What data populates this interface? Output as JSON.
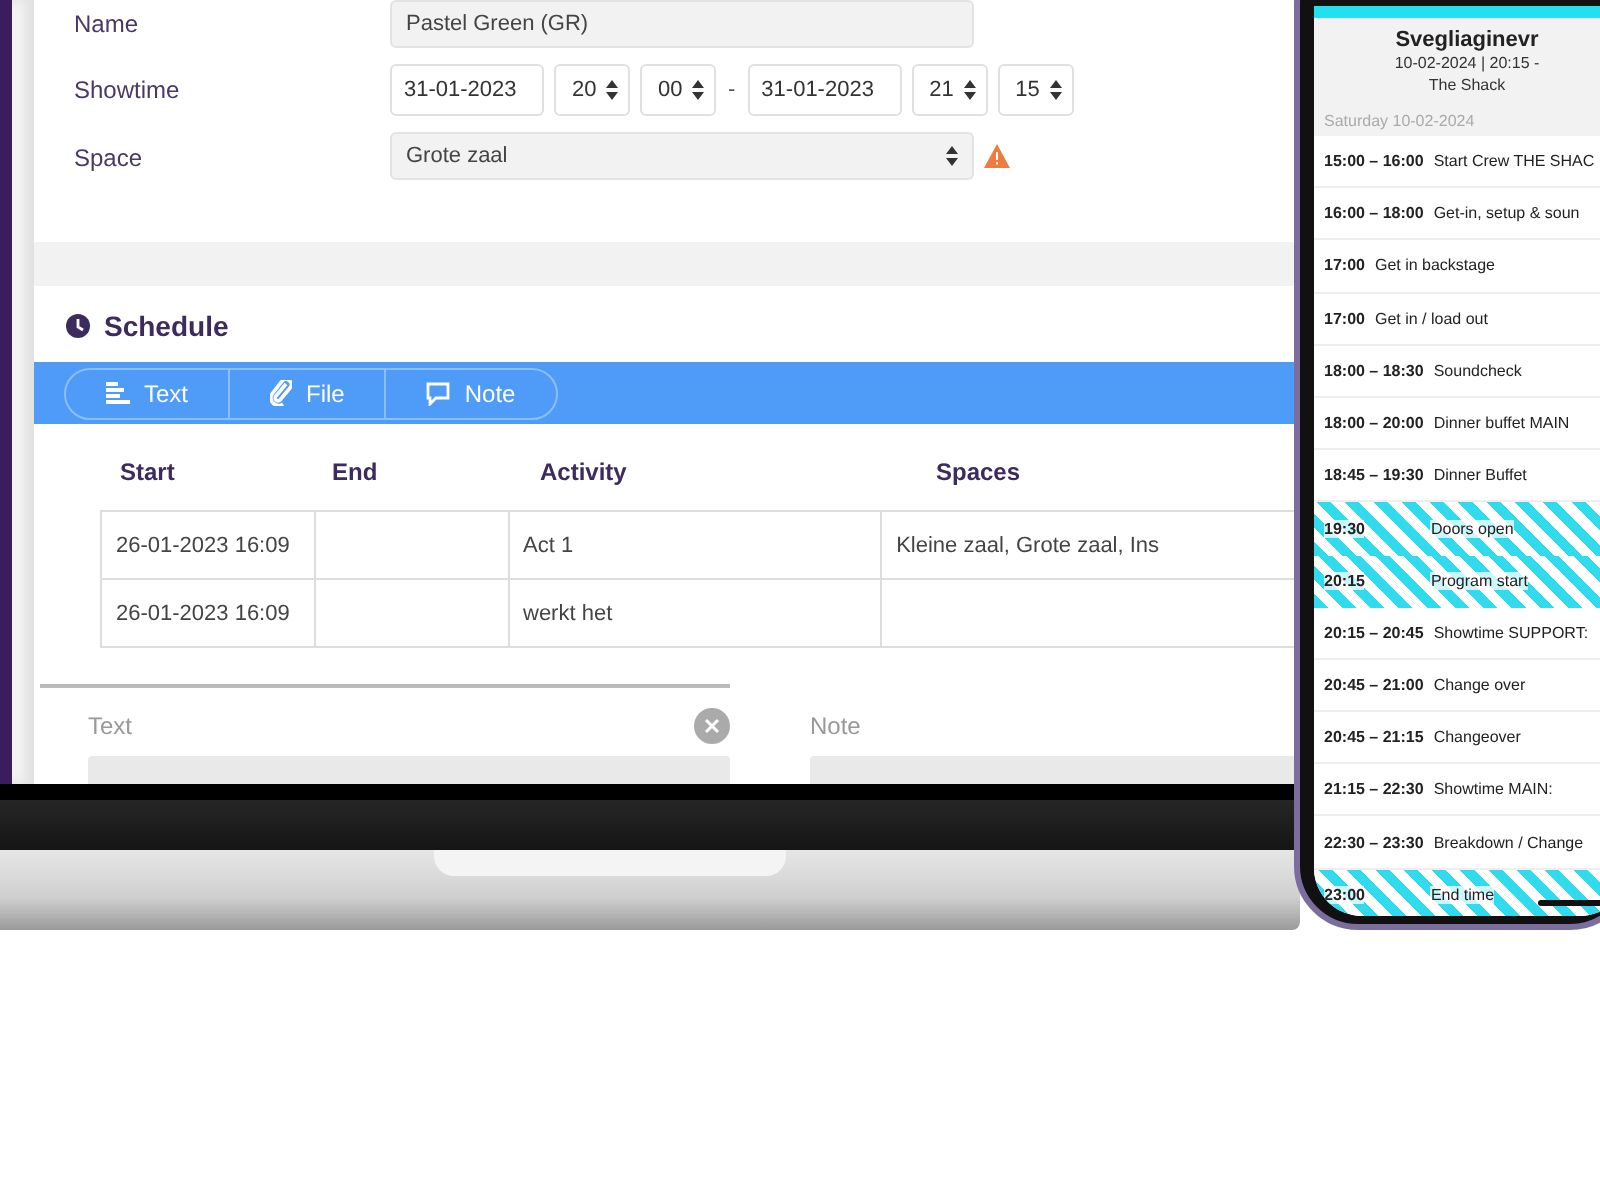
{
  "form": {
    "fields": [
      {
        "kind": "text",
        "label": "Name",
        "value": "Pastel Green (GR)"
      },
      {
        "kind": "range",
        "label": "Showtime",
        "parts": [
          {
            "kind": "date",
            "value": "31-01-2023"
          },
          {
            "kind": "spin",
            "value": "20"
          },
          {
            "kind": "spin",
            "value": "00"
          },
          {
            "kind": "separator",
            "value": "-"
          },
          {
            "kind": "date",
            "value": "31-01-2023"
          },
          {
            "kind": "spin",
            "value": "21"
          },
          {
            "kind": "spin",
            "value": "15"
          }
        ]
      },
      {
        "kind": "select",
        "label": "Space",
        "value": "Grote zaal",
        "warning": true
      }
    ]
  },
  "schedule": {
    "title": "Schedule",
    "toolbar": [
      {
        "kind": "text",
        "label": "Text"
      },
      {
        "kind": "file",
        "label": "File"
      },
      {
        "kind": "note",
        "label": "Note"
      }
    ],
    "table": {
      "columns": [
        "Start",
        "End",
        "Activity",
        "Spaces"
      ],
      "rows": [
        [
          "26-01-2023 16:09",
          null,
          "Act 1",
          "Kleine zaal, Grote zaal, Ins"
        ],
        [
          "26-01-2023 16:09",
          null,
          "werkt het",
          null
        ]
      ]
    },
    "editors": [
      {
        "label": "Text",
        "closable": true
      },
      {
        "label": "Note",
        "closable": false
      }
    ]
  },
  "phone": {
    "title": "Svegliaginevr",
    "subtitle": "10-02-2024 | 20:15 -",
    "venue": "The Shack",
    "day": "Saturday 10-02-2024",
    "items": [
      {
        "time": "15:00 – 16:00",
        "activity": "Start Crew THE SHAC",
        "highlighted": false
      },
      {
        "time": "16:00 – 18:00",
        "activity": "Get-in, setup & soun",
        "highlighted": false
      },
      {
        "time": "17:00",
        "activity": "Get in backstage",
        "highlighted": false
      },
      {
        "time": "17:00",
        "activity": "Get in / load out",
        "highlighted": false
      },
      {
        "time": "18:00 – 18:30",
        "activity": "Soundcheck",
        "highlighted": false
      },
      {
        "time": "18:00 – 20:00",
        "activity": "Dinner buffet MAIN",
        "highlighted": false
      },
      {
        "time": "18:45 – 19:30",
        "activity": "Dinner Buffet",
        "highlighted": false
      },
      {
        "time": "19:30",
        "activity": "Doors open",
        "highlighted": true
      },
      {
        "time": "20:15",
        "activity": "Program start",
        "highlighted": true
      },
      {
        "time": "20:15 – 20:45",
        "activity": "Showtime SUPPORT:",
        "highlighted": false
      },
      {
        "time": "20:45 – 21:00",
        "activity": "Change over",
        "highlighted": false
      },
      {
        "time": "20:45 – 21:15",
        "activity": "Changeover",
        "highlighted": false
      },
      {
        "time": "21:15 – 22:30",
        "activity": "Showtime MAIN:",
        "highlighted": false
      },
      {
        "time": "22:30 – 23:30",
        "activity": "Breakdown / Change",
        "highlighted": false
      },
      {
        "time": "23:00",
        "activity": "End time",
        "highlighted": true
      }
    ]
  }
}
